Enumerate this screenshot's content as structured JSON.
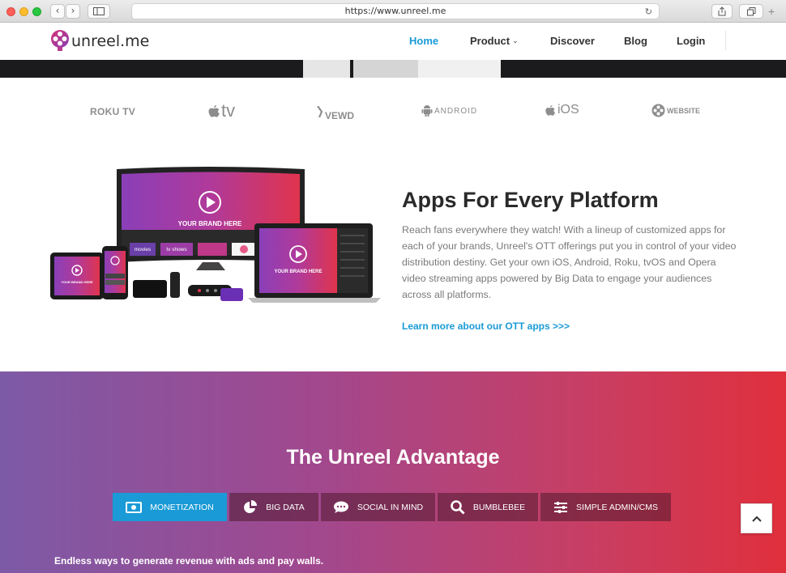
{
  "browser": {
    "url": "https://www.unreel.me"
  },
  "header": {
    "logo_text": "unreel.me",
    "nav": [
      {
        "label": "Home",
        "active": true
      },
      {
        "label": "Product",
        "active": false
      },
      {
        "label": "Discover",
        "active": false
      },
      {
        "label": "Blog",
        "active": false
      },
      {
        "label": "Login",
        "active": false
      }
    ]
  },
  "platforms": {
    "roku": "ROKU TV",
    "appletv": "tv",
    "vewd": "VEWD",
    "android": "ANDROID",
    "ios": "iOS",
    "website": "WEBSITE"
  },
  "devices": {
    "tv_brand": "YOUR BRAND HERE",
    "laptop_brand": "YOUR BRAND HERE",
    "tablet_brand": "YOUR BRAND HERE",
    "phone_brand": "YOUR BRAND HERE",
    "tile_movies": "movies",
    "tile_tvshows": "tv shows",
    "tile_brand": "YOUR BRAND HERE"
  },
  "apps": {
    "title": "Apps For Every Platform",
    "description": "Reach fans everywhere they watch! With a lineup of customized apps for each of your brands, Unreel's OTT offerings put you in control of your video distribution destiny. Get your own iOS, Android, Roku, tvOS and Opera video streaming apps powered by Big Data to engage your audiences across all platforms.",
    "link": "Learn more about our OTT apps >>>"
  },
  "advantage": {
    "title": "The Unreel Advantage",
    "tabs": [
      {
        "label": "MONETIZATION",
        "icon": "money-icon",
        "active": true
      },
      {
        "label": "BIG DATA",
        "icon": "pie-chart-icon",
        "active": false
      },
      {
        "label": "SOCIAL IN MIND",
        "icon": "chat-icon",
        "active": false
      },
      {
        "label": "BUMBLEBEE",
        "icon": "search-icon",
        "active": false
      },
      {
        "label": "SIMPLE ADMIN/CMS",
        "icon": "sliders-icon",
        "active": false
      }
    ],
    "text": "Endless ways to generate revenue with ads and pay walls."
  },
  "colors": {
    "accent": "#1a9ad6",
    "gradient_start": "#7d5aa6",
    "gradient_end": "#e02f3c"
  }
}
